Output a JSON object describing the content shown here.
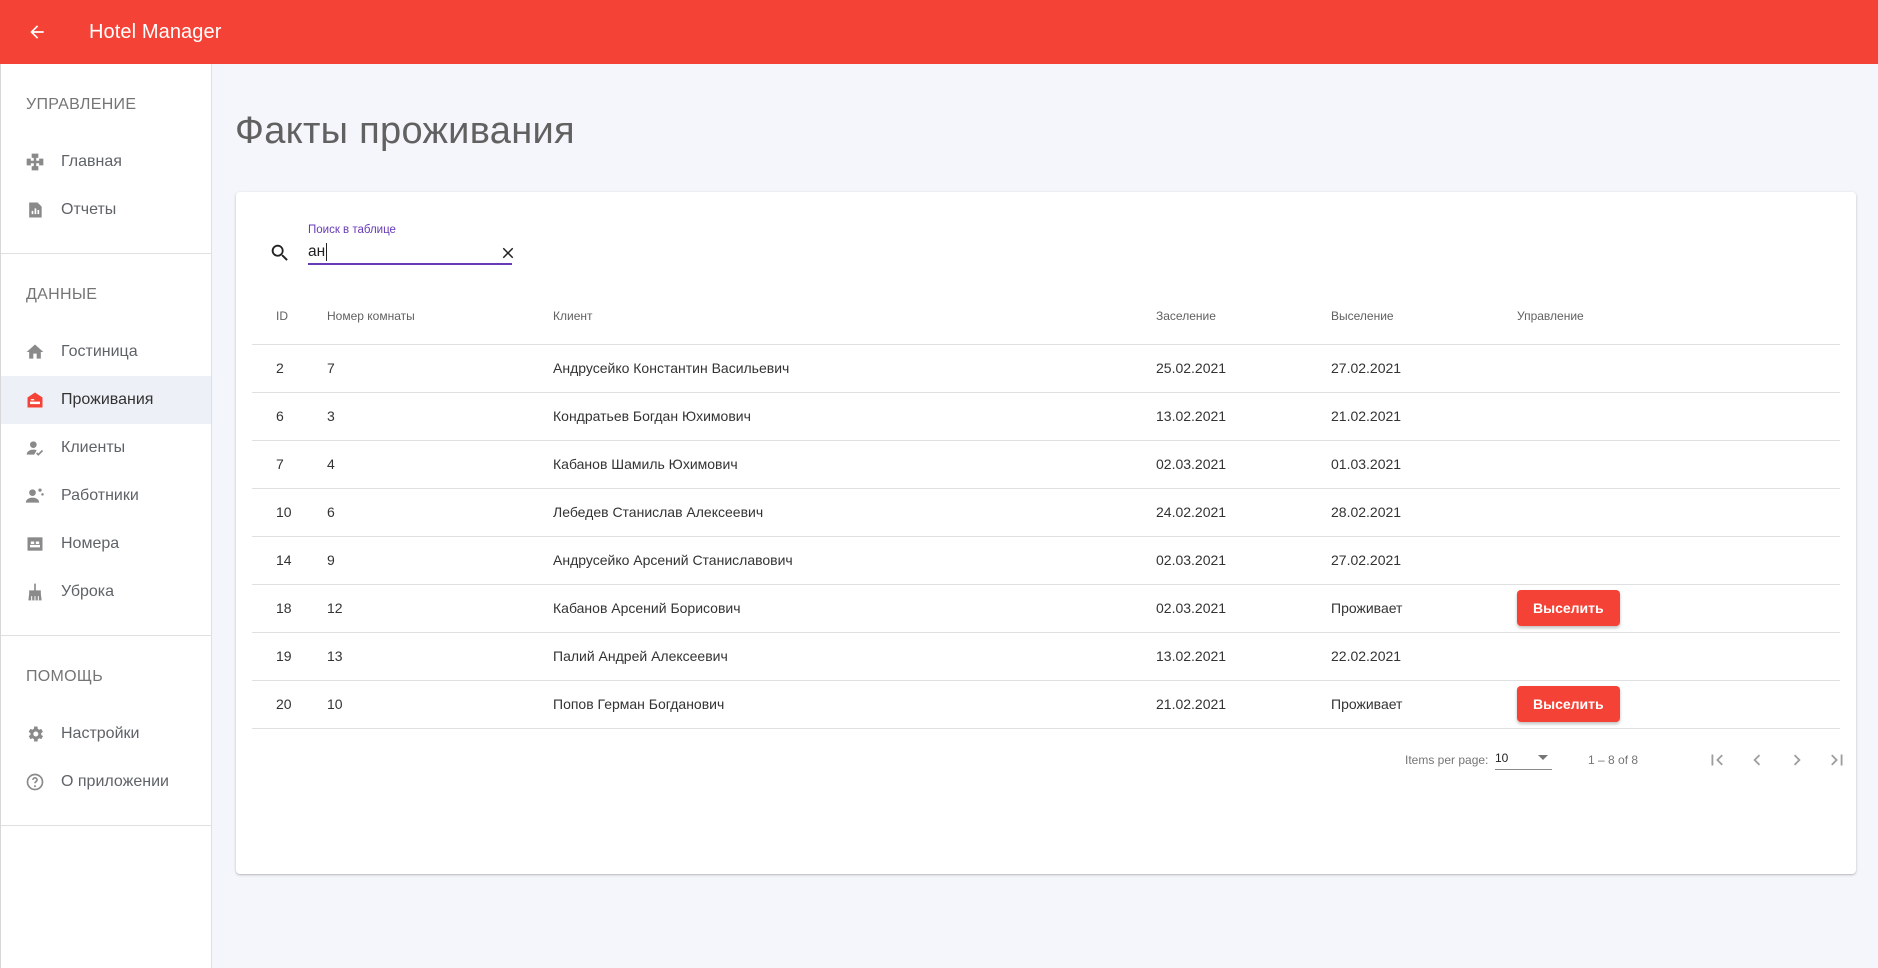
{
  "app": {
    "title": "Hotel Manager",
    "accent": "#f44336"
  },
  "sidebar": {
    "sections": [
      {
        "title": "УПРАВЛЕНИЕ",
        "items": [
          {
            "label": "Главная",
            "icon": "dashboard-icon"
          },
          {
            "label": "Отчеты",
            "icon": "report-icon"
          }
        ]
      },
      {
        "title": "ДАННЫЕ",
        "items": [
          {
            "label": "Гостиница",
            "icon": "home-icon"
          },
          {
            "label": "Проживания",
            "icon": "hotel-icon",
            "active": true
          },
          {
            "label": "Клиенты",
            "icon": "client-icon"
          },
          {
            "label": "Работники",
            "icon": "workers-icon"
          },
          {
            "label": "Номера",
            "icon": "bed-icon"
          },
          {
            "label": "Уброка",
            "icon": "cleaning-icon"
          }
        ]
      },
      {
        "title": "ПОМОЩЬ",
        "items": [
          {
            "label": "Настройки",
            "icon": "gear-icon"
          },
          {
            "label": "О приложении",
            "icon": "help-icon"
          }
        ]
      }
    ]
  },
  "page": {
    "title": "Факты проживания"
  },
  "search": {
    "label": "Поиск в таблице",
    "value": "ан"
  },
  "table": {
    "columns": [
      "ID",
      "Номер комнаты",
      "Клиент",
      "Заселение",
      "Выселение",
      "Управление"
    ],
    "rows": [
      {
        "id": "2",
        "room": "7",
        "client": "Андрусейко Константин Васильевич",
        "check_in": "25.02.2021",
        "check_out": "27.02.2021",
        "action": ""
      },
      {
        "id": "6",
        "room": "3",
        "client": "Кондратьев Богдан Юхимович",
        "check_in": "13.02.2021",
        "check_out": "21.02.2021",
        "action": ""
      },
      {
        "id": "7",
        "room": "4",
        "client": "Кабанов Шамиль Юхимович",
        "check_in": "02.03.2021",
        "check_out": "01.03.2021",
        "action": ""
      },
      {
        "id": "10",
        "room": "6",
        "client": "Лебедев Станислав Алексеевич",
        "check_in": "24.02.2021",
        "check_out": "28.02.2021",
        "action": ""
      },
      {
        "id": "14",
        "room": "9",
        "client": "Андрусейко Арсений Станиславович",
        "check_in": "02.03.2021",
        "check_out": "27.02.2021",
        "action": ""
      },
      {
        "id": "18",
        "room": "12",
        "client": "Кабанов Арсений Борисович",
        "check_in": "02.03.2021",
        "check_out": "Проживает",
        "action": "Выселить"
      },
      {
        "id": "19",
        "room": "13",
        "client": "Палий Андрей Алексеевич",
        "check_in": "13.02.2021",
        "check_out": "22.02.2021",
        "action": ""
      },
      {
        "id": "20",
        "room": "10",
        "client": "Попов Герман Богданович",
        "check_in": "21.02.2021",
        "check_out": "Проживает",
        "action": "Выселить"
      }
    ]
  },
  "paginator": {
    "items_per_page_label": "Items per page:",
    "page_size": "10",
    "range": "1 – 8 of 8"
  }
}
